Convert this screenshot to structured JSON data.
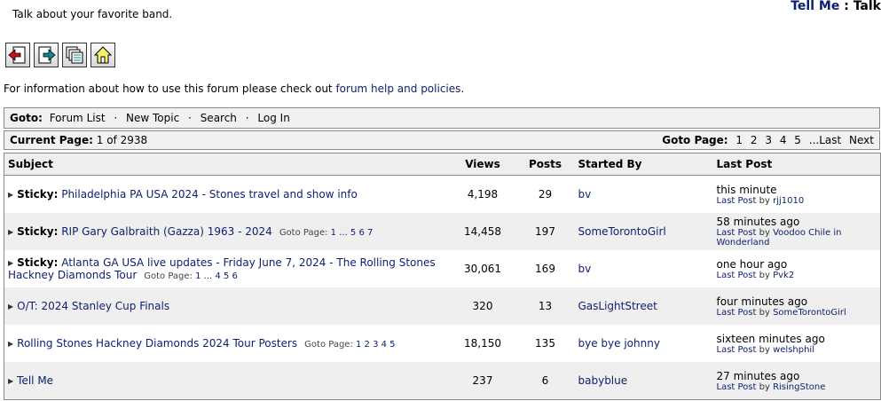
{
  "header": {
    "description": "Talk about your favorite band.",
    "brand": "Tell Me",
    "brand_sep": ":",
    "section": "Talk"
  },
  "toolbar": {
    "icons": [
      "back-arrow-icon",
      "forward-arrow-icon",
      "list-pages-icon",
      "home-icon"
    ]
  },
  "info": {
    "prefix": "For information about how to use this forum please check out ",
    "link": "forum help and policies",
    "suffix": "."
  },
  "goto": {
    "label": "Goto:",
    "items": [
      "Forum List",
      "New Topic",
      "Search",
      "Log In"
    ],
    "sep": "·"
  },
  "pager": {
    "label": "Current Page:",
    "current": "1",
    "of": "of",
    "total": "2938",
    "goto_label": "Goto Page:",
    "pages": [
      "1",
      "2",
      "3",
      "4",
      "5"
    ],
    "last": "...Last",
    "next": "Next"
  },
  "table": {
    "headers": [
      "Subject",
      "Views",
      "Posts",
      "Started By",
      "Last Post"
    ],
    "rows": [
      {
        "sticky": "Sticky:",
        "title": "Philadelphia PA USA 2024 - Stones travel and show info",
        "views": "4,198",
        "posts": "29",
        "starter": "bv",
        "last_time": "this minute",
        "last_label": "Last Post",
        "last_by_word": "by",
        "last_by": "rjj1010",
        "goto": ""
      },
      {
        "sticky": "Sticky:",
        "title": "RIP Gary Galbraith (Gazza) 1963 - 2024",
        "views": "14,458",
        "posts": "197",
        "starter": "SomeTorontoGirl",
        "last_time": "58 minutes ago",
        "last_label": "Last Post",
        "last_by_word": "by",
        "last_by": "Voodoo Chile in Wonderland",
        "goto": "Goto Page:",
        "goto_pages": "1 ... 5 6 7"
      },
      {
        "sticky": "Sticky:",
        "title": "Atlanta GA USA live updates - Friday June 7, 2024 - The Rolling Stones Hackney Diamonds Tour",
        "views": "30,061",
        "posts": "169",
        "starter": "bv",
        "last_time": "one hour ago",
        "last_label": "Last Post",
        "last_by_word": "by",
        "last_by": "Pvk2",
        "goto": "Goto Page:",
        "goto_pages": "1 ... 4 5 6"
      },
      {
        "sticky": "",
        "title": "O/T: 2024 Stanley Cup Finals",
        "views": "320",
        "posts": "13",
        "starter": "GasLightStreet",
        "last_time": "four minutes ago",
        "last_label": "Last Post",
        "last_by_word": "by",
        "last_by": "SomeTorontoGirl",
        "goto": ""
      },
      {
        "sticky": "",
        "title": "Rolling Stones Hackney Diamonds 2024 Tour Posters",
        "views": "18,150",
        "posts": "135",
        "starter": "bye bye johnny",
        "last_time": "sixteen minutes ago",
        "last_label": "Last Post",
        "last_by_word": "by",
        "last_by": "welshphil",
        "goto": "Goto Page:",
        "goto_pages": "1 2 3 4 5"
      },
      {
        "sticky": "",
        "title": "Tell Me",
        "views": "237",
        "posts": "6",
        "starter": "babyblue",
        "last_time": "27 minutes ago",
        "last_label": "Last Post",
        "last_by_word": "by",
        "last_by": "RisingStone",
        "goto": ""
      }
    ]
  }
}
